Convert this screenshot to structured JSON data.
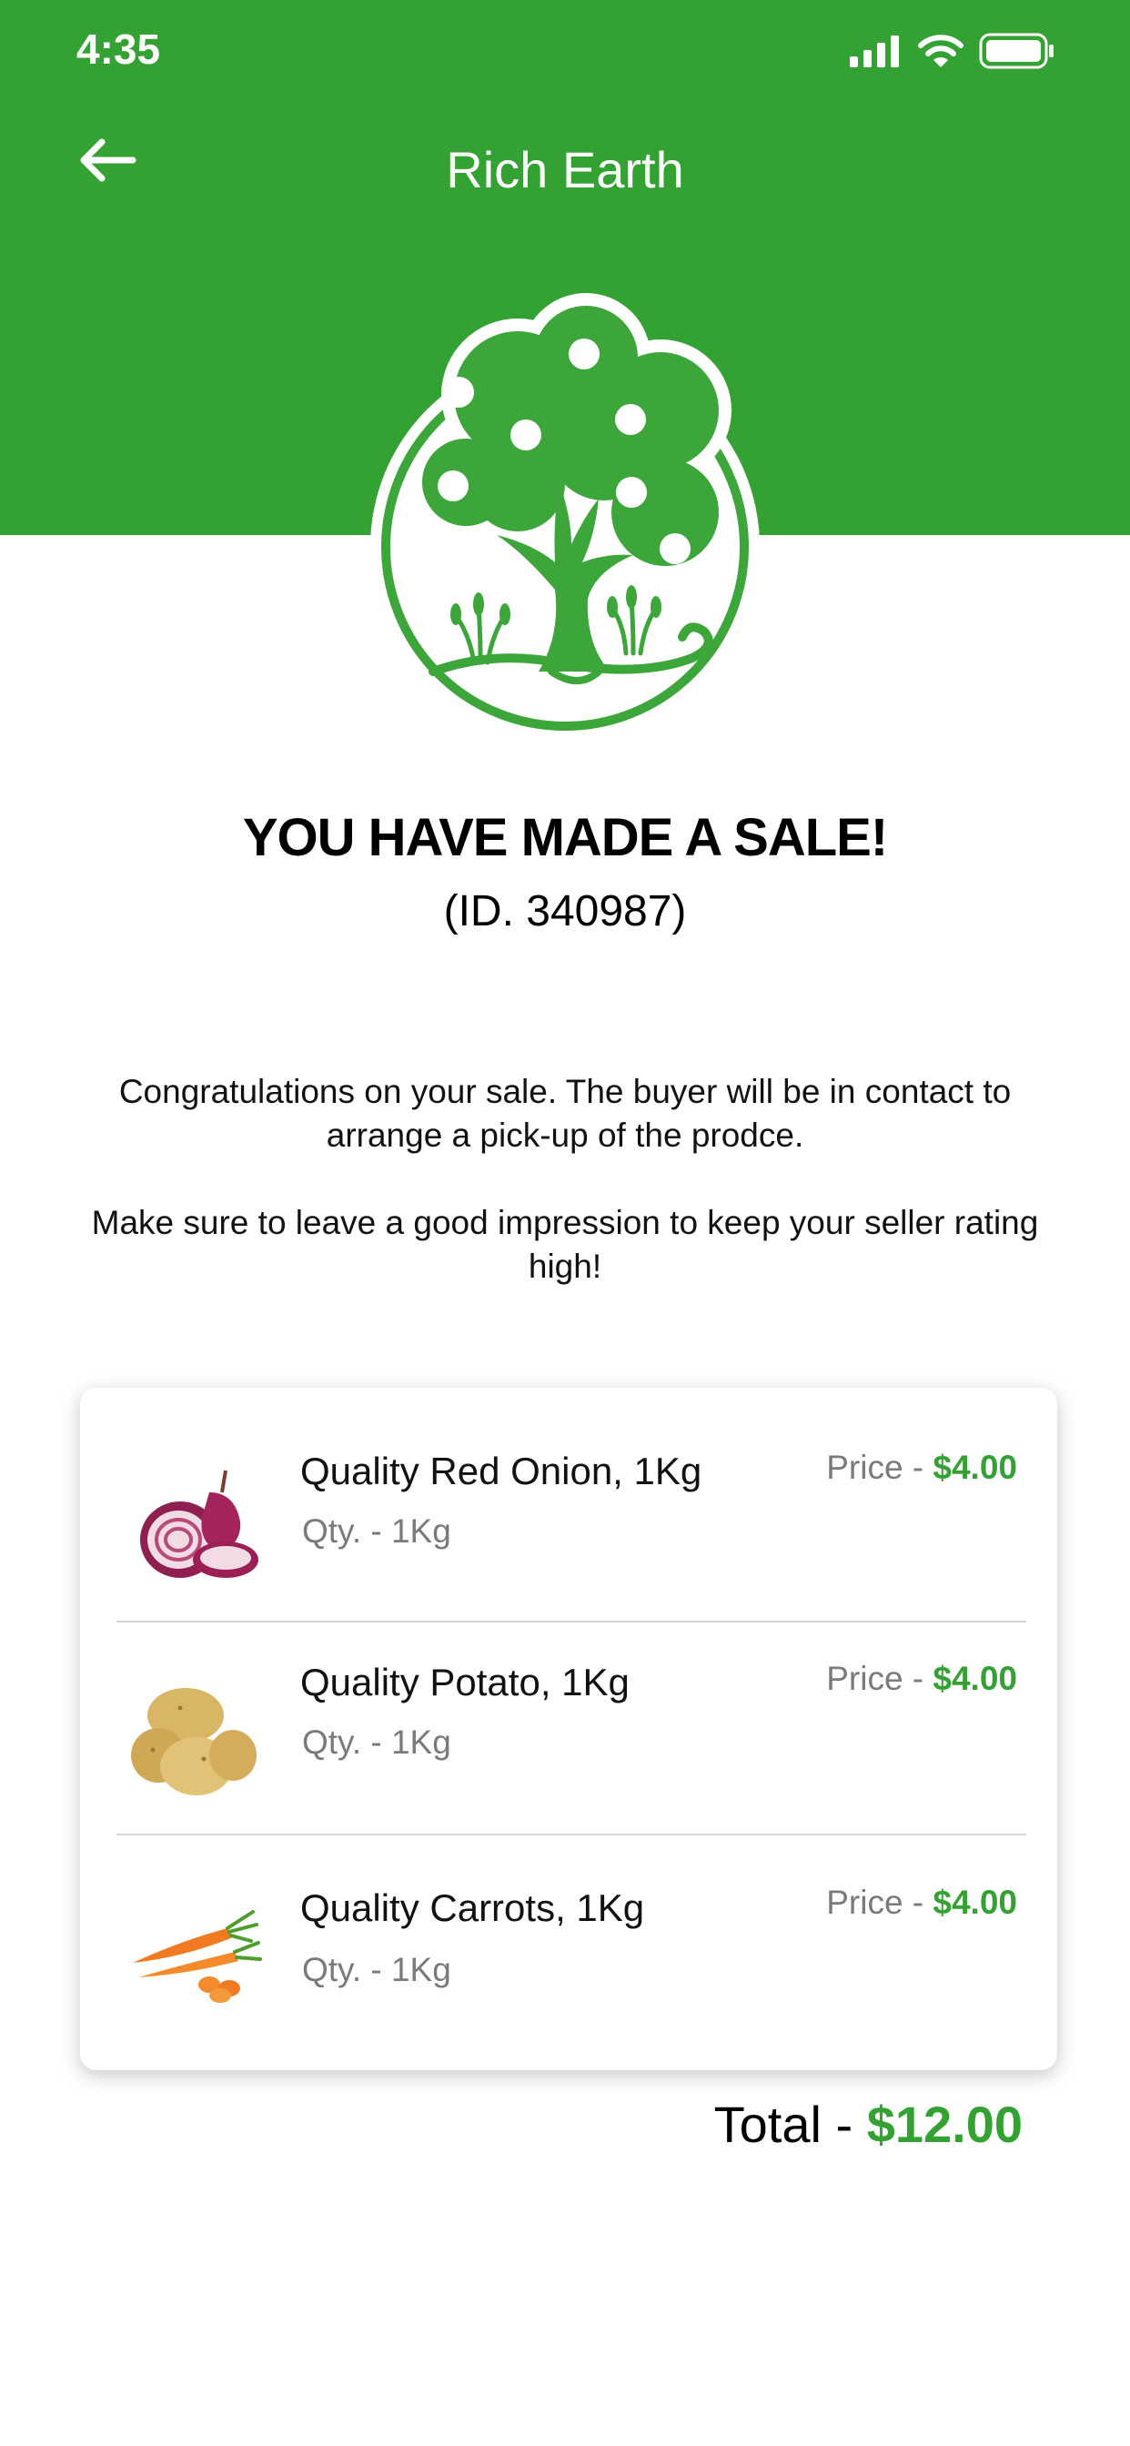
{
  "status_bar": {
    "time": "4:35"
  },
  "header": {
    "title": "Rich Earth",
    "back_icon": "arrow-left-icon"
  },
  "logo": {
    "name": "tree-logo-icon"
  },
  "sale": {
    "title": "YOU HAVE MADE A SALE!",
    "id_text": "(ID. 340987)"
  },
  "messages": {
    "congrats": "Congratulations on your sale. The buyer will be in contact to arrange a pick-up of the prodce.",
    "reminder": "Make sure to leave a good impression to keep your seller rating high!"
  },
  "items": [
    {
      "name": "Quality Red Onion, 1Kg",
      "qty": "Qty. - 1Kg",
      "price_label": "Price - ",
      "price": "$4.00",
      "image": "red-onion-image"
    },
    {
      "name": "Quality Potato, 1Kg",
      "qty": "Qty. - 1Kg",
      "price_label": "Price - ",
      "price": "$4.00",
      "image": "potato-image"
    },
    {
      "name": "Quality Carrots, 1Kg",
      "qty": "Qty. - 1Kg",
      "price_label": "Price - ",
      "price": "$4.00",
      "image": "carrots-image"
    }
  ],
  "total": {
    "label": "Total - ",
    "amount": "$12.00"
  },
  "colors": {
    "brand_green": "#34a232",
    "muted_text": "#7a7a7a"
  }
}
